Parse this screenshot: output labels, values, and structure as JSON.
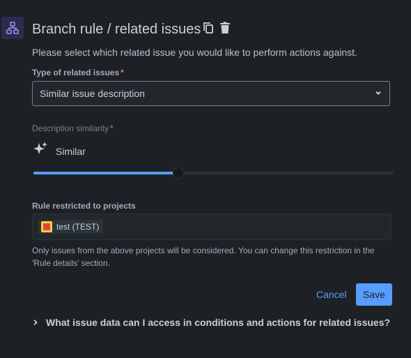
{
  "header": {
    "title": "Branch rule / related issues",
    "icons": [
      "branch-rule-icon",
      "copy-icon",
      "trash-icon"
    ]
  },
  "intro": "Please select which related issue you would like to perform actions against.",
  "related_type": {
    "label": "Type of related issues",
    "required_mark": "*",
    "value": "Similar issue description"
  },
  "similarity": {
    "label": "Description similarity",
    "required_mark": "*",
    "value_label": "Similar",
    "slider_fraction": 0.4
  },
  "projects": {
    "label": "Rule restricted to projects",
    "chip": "test (TEST)",
    "help": "Only issues from the above projects will be considered. You can change this restriction in the 'Rule details' section."
  },
  "actions": {
    "cancel": "Cancel",
    "save": "Save"
  },
  "faq": "What issue data can I access in conditions and actions for related issues?",
  "colors": {
    "background": "#1d2125",
    "accent": "#579dff",
    "required": "#f87168",
    "icon_bg": "#2b2c4d",
    "icon_fg": "#9f8fef"
  }
}
